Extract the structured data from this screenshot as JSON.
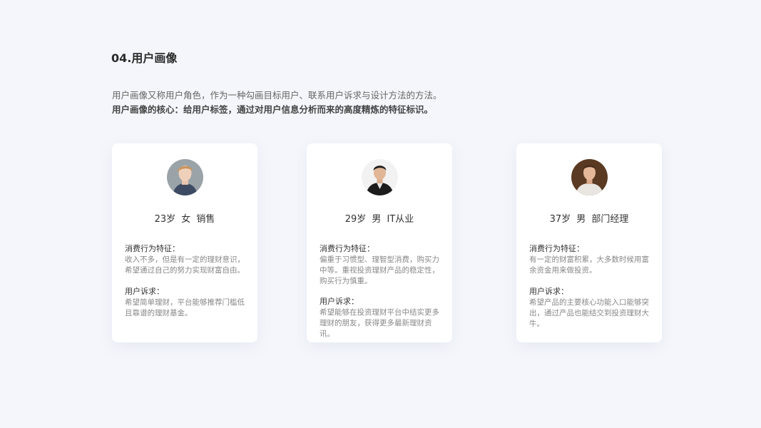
{
  "title": "04.用户画像",
  "intro": {
    "line1": "用户画像又称用户角色，作为一种勾画目标用户、联系用户诉求与设计方法的方法。",
    "line2": "用户画像的核心：给用户标签，通过对用户信息分析而来的高度精炼的特征标识。"
  },
  "cards": [
    {
      "label": "23岁  女  销售",
      "behavior_title": "消费行为特征：",
      "behavior_text": "收入不多，但是有一定的理财意识，希望通过自己的努力实现财富自由。",
      "demand_title": "用户诉求：",
      "demand_text": "希望简单理财，平台能够推荐门槛低且靠谱的理财基金。"
    },
    {
      "label": "29岁  男  IT从业",
      "behavior_title": "消费行为特征：",
      "behavior_text": "偏重于习惯型、理智型消费，购买力中等。重视投资理财产品的稳定性，购买行为慎重。",
      "demand_title": "用户诉求：",
      "demand_text": "希望能够在投资理财平台中结实更多理财的朋友，获得更多最新理财资讯。"
    },
    {
      "label": "37岁  男  部门经理",
      "behavior_title": "消费行为特征：",
      "behavior_text": "有一定的财富积累，大多数时候用富余资金用来做投资。",
      "demand_title": "用户诉求：",
      "demand_text": "希望产品的主要核心功能入口能够突出，通过产品也能结交到投资理财大牛。"
    }
  ]
}
